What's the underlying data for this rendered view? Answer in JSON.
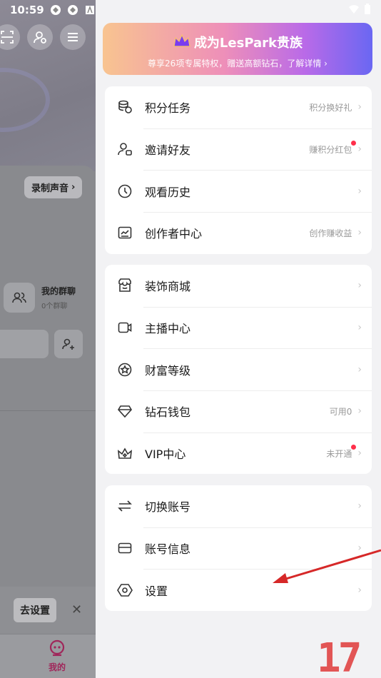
{
  "status_bar": {
    "time": "10:59"
  },
  "background_page": {
    "record_button": "录制声音",
    "group_title": "我的群聊",
    "group_subtitle": "0个群聊",
    "notify_button": "去设置",
    "nav_mine": "我的"
  },
  "banner": {
    "title": "成为LesPark贵族",
    "subtitle": "尊享26项专属特权，赠送高额钻石，了解详情"
  },
  "menu_group1": [
    {
      "icon": "coins-icon",
      "label": "积分任务",
      "sub": "积分换好礼",
      "dot": false
    },
    {
      "icon": "invite-friend-icon",
      "label": "邀请好友",
      "sub": "赚积分红包",
      "dot": true
    },
    {
      "icon": "history-clock-icon",
      "label": "观看历史",
      "sub": "",
      "dot": false
    },
    {
      "icon": "creator-chart-icon",
      "label": "创作者中心",
      "sub": "创作赚收益",
      "dot": false
    }
  ],
  "menu_group2": [
    {
      "icon": "shop-icon",
      "label": "装饰商城",
      "sub": "",
      "dot": false
    },
    {
      "icon": "camera-icon",
      "label": "主播中心",
      "sub": "",
      "dot": false
    },
    {
      "icon": "wealth-badge-icon",
      "label": "财富等级",
      "sub": "",
      "dot": false
    },
    {
      "icon": "diamond-icon",
      "label": "钻石钱包",
      "sub": "可用0",
      "dot": false
    },
    {
      "icon": "crown-icon",
      "label": "VIP中心",
      "sub": "未开通",
      "dot": true
    }
  ],
  "menu_group3": [
    {
      "icon": "switch-arrows-icon",
      "label": "切换账号",
      "sub": "",
      "dot": false
    },
    {
      "icon": "wallet-card-icon",
      "label": "账号信息",
      "sub": "",
      "dot": false
    },
    {
      "icon": "settings-hex-icon",
      "label": "设置",
      "sub": "",
      "dot": false
    }
  ],
  "colors": {
    "accent_dot": "#ff2f4a",
    "arrow": "#d62828"
  },
  "watermark": "17"
}
